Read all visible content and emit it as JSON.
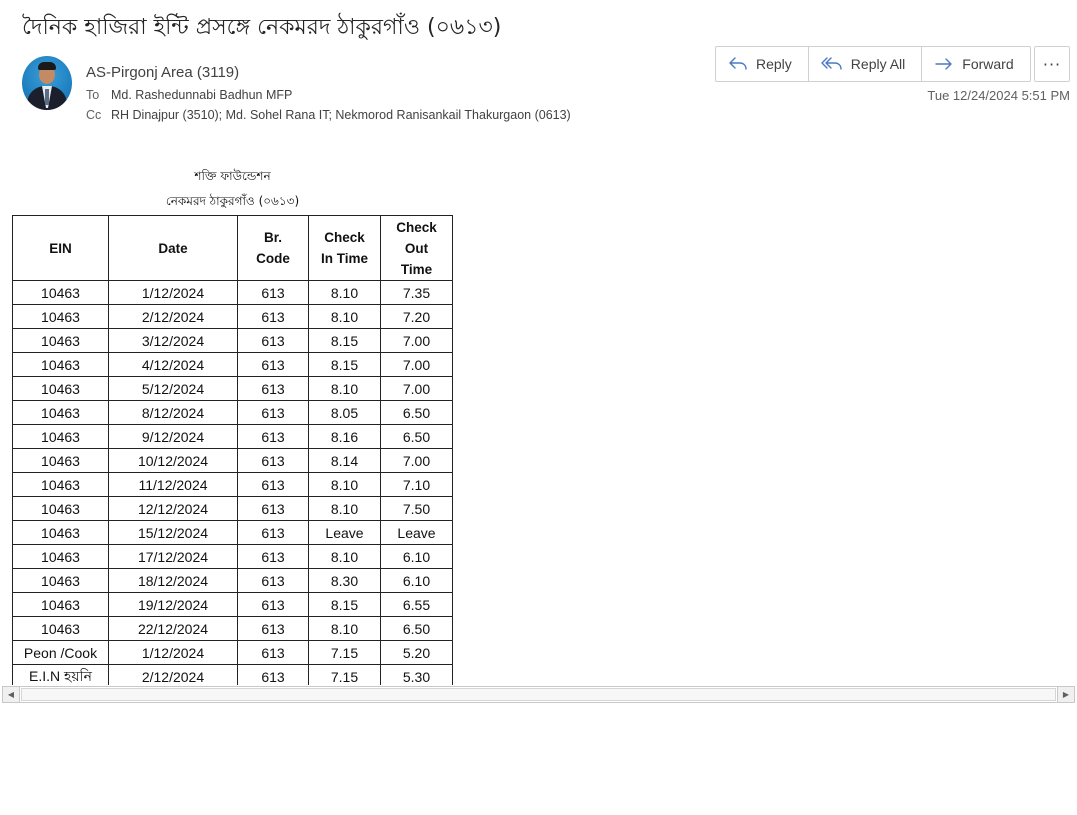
{
  "email": {
    "subject": "দৈনিক হাজিরা ইন্টি প্রসঙ্গে নেকমরদ ঠাকুরগাঁও (০৬১৩)",
    "sender": "AS-Pirgonj Area (3119)",
    "to_label": "To",
    "to": "Md. Rashedunnabi Badhun MFP",
    "cc_label": "Cc",
    "cc": "RH Dinajpur (3510); Md. Sohel Rana IT; Nekmorod  Ranisankail Thakurgaon (0613)",
    "date": "Tue 12/24/2024 5:51 PM"
  },
  "actions": {
    "reply": "Reply",
    "reply_all": "Reply All",
    "forward": "Forward",
    "more": "···"
  },
  "body": {
    "org_name": "শক্তি ফাউন্ডেশন",
    "branch": "নেকমরদ ঠাকুরগাঁও (০৬১৩)",
    "table": {
      "headers": [
        "EIN",
        "Date",
        "Br. Code",
        "Check In Time",
        "Check Out Time"
      ],
      "rows": [
        [
          "10463",
          "1/12/2024",
          "613",
          "8.10",
          "7.35"
        ],
        [
          "10463",
          "2/12/2024",
          "613",
          "8.10",
          "7.20"
        ],
        [
          "10463",
          "3/12/2024",
          "613",
          "8.15",
          "7.00"
        ],
        [
          "10463",
          "4/12/2024",
          "613",
          "8.15",
          "7.00"
        ],
        [
          "10463",
          "5/12/2024",
          "613",
          "8.10",
          "7.00"
        ],
        [
          "10463",
          "8/12/2024",
          "613",
          "8.05",
          "6.50"
        ],
        [
          "10463",
          "9/12/2024",
          "613",
          "8.16",
          "6.50"
        ],
        [
          "10463",
          "10/12/2024",
          "613",
          "8.14",
          "7.00"
        ],
        [
          "10463",
          "11/12/2024",
          "613",
          "8.10",
          "7.10"
        ],
        [
          "10463",
          "12/12/2024",
          "613",
          "8.10",
          "7.50"
        ],
        [
          "10463",
          "15/12/2024",
          "613",
          "Leave",
          "Leave"
        ],
        [
          "10463",
          "17/12/2024",
          "613",
          "8.10",
          "6.10"
        ],
        [
          "10463",
          "18/12/2024",
          "613",
          "8.30",
          "6.10"
        ],
        [
          "10463",
          "19/12/2024",
          "613",
          "8.15",
          "6.55"
        ],
        [
          "10463",
          "22/12/2024",
          "613",
          "8.10",
          "6.50"
        ],
        [
          "Peon /Cook",
          "1/12/2024",
          "613",
          "7.15",
          "5.20"
        ],
        [
          "E.I.N হয়নি",
          "2/12/2024",
          "613",
          "7.15",
          "5.30"
        ]
      ]
    }
  }
}
